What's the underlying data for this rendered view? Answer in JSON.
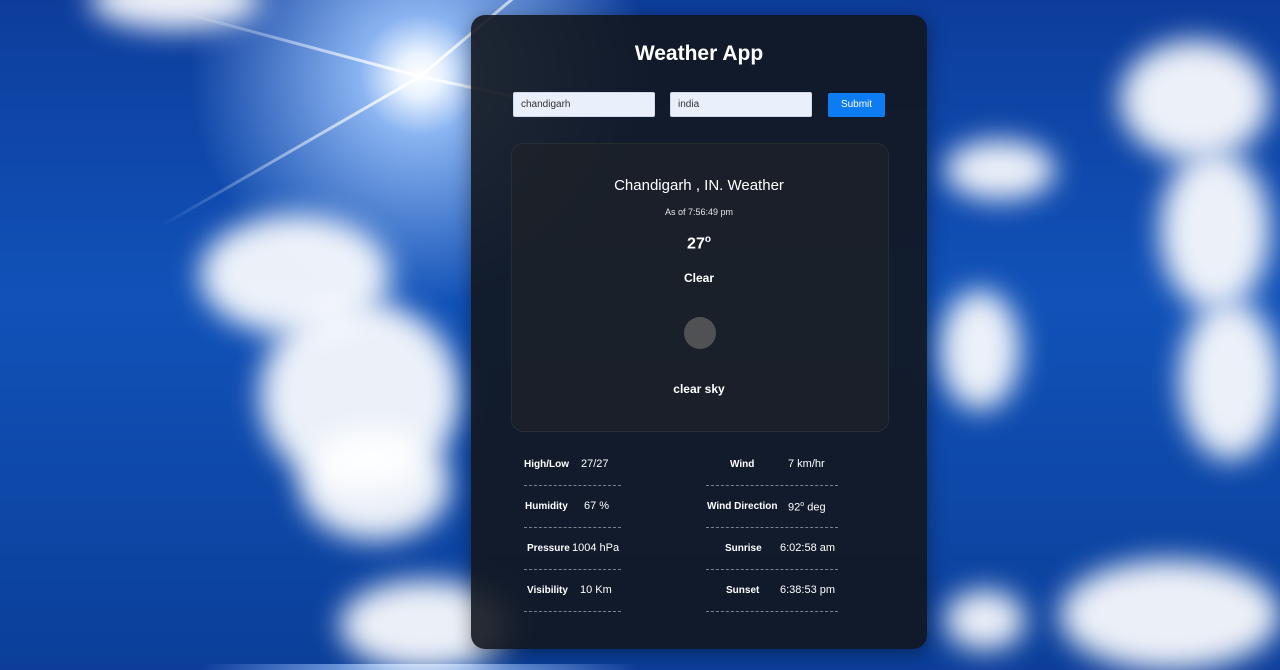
{
  "app": {
    "title": "Weather App"
  },
  "search": {
    "city_value": "chandigarh",
    "country_value": "india",
    "submit_label": "Submit"
  },
  "current": {
    "location": "Chandigarh , IN. Weather",
    "as_of": "As of 7:56:49 pm",
    "temperature": "27",
    "degree_symbol": "o",
    "condition": "Clear",
    "icon": "clear-sky-icon",
    "description": "clear sky"
  },
  "stats": {
    "high_low_label": "High/Low",
    "high_low_value": "27/27",
    "humidity_label": "Humidity",
    "humidity_value": "67 %",
    "pressure_label": "Pressure",
    "pressure_value": "1004 hPa",
    "visibility_label": "Visibility",
    "visibility_value": "10 Km",
    "wind_label": "Wind",
    "wind_value": "7 km/hr",
    "wind_direction_label": "Wind Direction",
    "wind_direction_value": "92",
    "wind_direction_unit": " deg",
    "sunrise_label": "Sunrise",
    "sunrise_value": "6:02:58 am",
    "sunset_label": "Sunset",
    "sunset_value": "6:38:53 pm"
  }
}
